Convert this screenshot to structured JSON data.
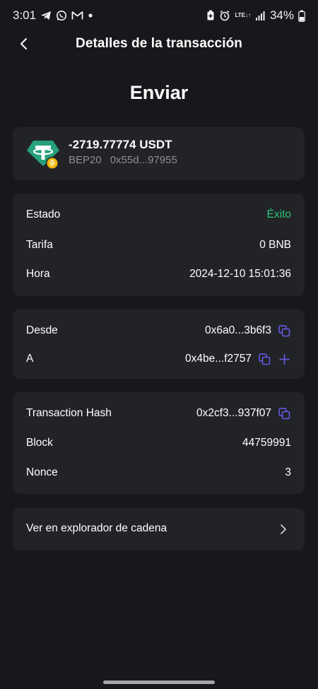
{
  "status_bar": {
    "time": "3:01",
    "battery": "34%",
    "network": [
      "LTE",
      "↓↑"
    ]
  },
  "header": {
    "title": "Detalles de la transacción"
  },
  "page_title": "Enviar",
  "token": {
    "amount": "-2719.77774 USDT",
    "network": "BEP20",
    "address": "0x55d...97955",
    "logo_color": "#27a17b"
  },
  "status_card": {
    "estado_label": "Estado",
    "estado_value": "Éxito",
    "tarifa_label": "Tarifa",
    "tarifa_value": "0 BNB",
    "hora_label": "Hora",
    "hora_value": "2024-12-10 15:01:36"
  },
  "address_card": {
    "desde_label": "Desde",
    "desde_value": "0x6a0...3b6f3",
    "a_label": "A",
    "a_value": "0x4be...f2757"
  },
  "hash_card": {
    "hash_label": "Transaction Hash",
    "hash_value": "0x2cf3...937f07",
    "block_label": "Block",
    "block_value": "44759991",
    "nonce_label": "Nonce",
    "nonce_value": "3"
  },
  "explorer": {
    "label": "Ver en explorador de cadena"
  },
  "colors": {
    "background": "#17181c",
    "card": "#222327",
    "success": "#2ec57a",
    "accent": "#6b5cf0"
  }
}
